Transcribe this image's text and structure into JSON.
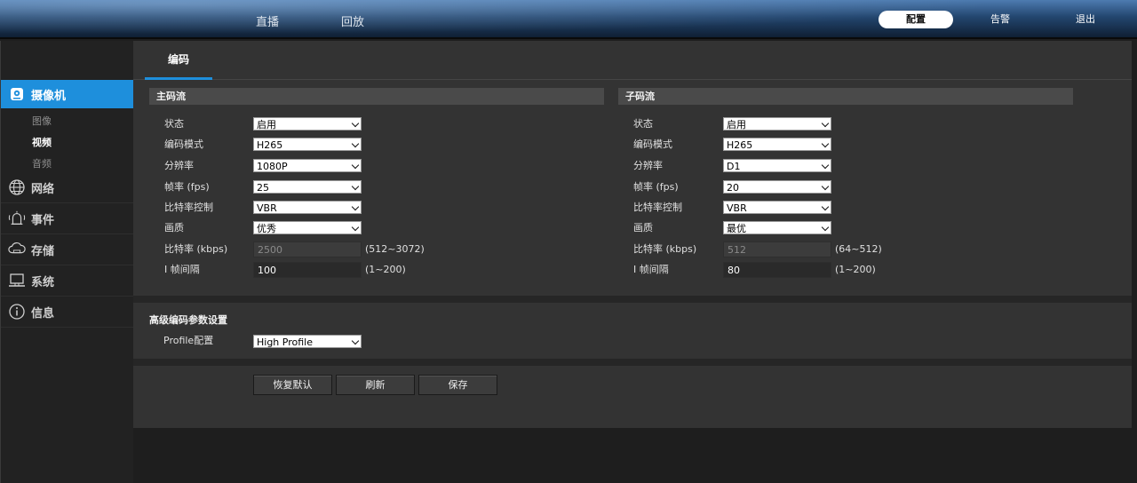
{
  "topnav": {
    "left": [
      "直播",
      "回放"
    ],
    "right": [
      {
        "label": "配置",
        "active": true
      },
      {
        "label": "告警",
        "active": false
      },
      {
        "label": "退出",
        "active": false
      }
    ]
  },
  "sidebar": {
    "items": [
      {
        "label": "摄像机",
        "icon": "camera-icon",
        "active": true
      },
      {
        "label": "网络",
        "icon": "network-icon",
        "active": false
      },
      {
        "label": "事件",
        "icon": "alarm-icon",
        "active": false
      },
      {
        "label": "存储",
        "icon": "cloud-storage-icon",
        "active": false
      },
      {
        "label": "系统",
        "icon": "computer-icon",
        "active": false
      },
      {
        "label": "信息",
        "icon": "info-icon",
        "active": false
      }
    ],
    "subitems": [
      {
        "label": "图像",
        "active": false
      },
      {
        "label": "视频",
        "active": true
      },
      {
        "label": "音频",
        "active": false
      }
    ]
  },
  "tabs": [
    "编码"
  ],
  "main_stream": {
    "title": "主码流",
    "fields": [
      {
        "label": "状态",
        "type": "select",
        "value": "启用"
      },
      {
        "label": "编码模式",
        "type": "select",
        "value": "H265"
      },
      {
        "label": "分辨率",
        "type": "select",
        "value": "1080P"
      },
      {
        "label": "帧率 (fps)",
        "type": "select",
        "value": "25"
      },
      {
        "label": "比特率控制",
        "type": "select",
        "value": "VBR"
      },
      {
        "label": "画质",
        "type": "select",
        "value": "优秀"
      },
      {
        "label": "比特率 (kbps)",
        "type": "input",
        "value": "2500",
        "disabled": true,
        "range": "(512~3072)"
      },
      {
        "label": "I 帧间隔",
        "type": "input",
        "value": "100",
        "disabled": false,
        "range": "(1~200)"
      }
    ]
  },
  "sub_stream": {
    "title": "子码流",
    "fields": [
      {
        "label": "状态",
        "type": "select",
        "value": "启用"
      },
      {
        "label": "编码模式",
        "type": "select",
        "value": "H265"
      },
      {
        "label": "分辨率",
        "type": "select",
        "value": "D1"
      },
      {
        "label": "帧率 (fps)",
        "type": "select",
        "value": "20"
      },
      {
        "label": "比特率控制",
        "type": "select",
        "value": "VBR"
      },
      {
        "label": "画质",
        "type": "select",
        "value": "最优"
      },
      {
        "label": "比特率 (kbps)",
        "type": "input",
        "value": "512",
        "disabled": true,
        "range": "(64~512)"
      },
      {
        "label": "I 帧间隔",
        "type": "input",
        "value": "80",
        "disabled": false,
        "range": "(1~200)"
      }
    ]
  },
  "advanced": {
    "title": "高级编码参数设置",
    "profile_label": "Profile配置",
    "profile_value": "High Profile"
  },
  "buttons": {
    "restore": "恢复默认",
    "refresh": "刷新",
    "save": "保存"
  },
  "colors": {
    "accent": "#1e8fdc",
    "panel": "#333333",
    "background": "#1e1e1e"
  }
}
